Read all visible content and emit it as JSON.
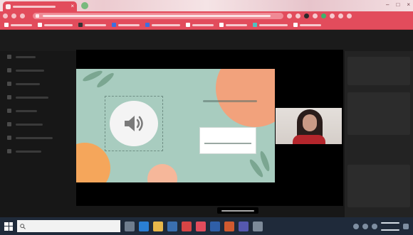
{
  "browser": {
    "active_tab": {
      "title": "",
      "icon": "video-call-icon"
    },
    "new_tab_icon": "plus-icon",
    "address": {
      "url": ""
    },
    "accent": "#e24c5c"
  },
  "bookmarks": [
    {
      "label": "",
      "icon": "bookmark-icon",
      "color": "#ffffff"
    },
    {
      "label": "",
      "icon": "bookmark-icon",
      "color": "#ffffff"
    },
    {
      "label": "",
      "icon": "bookmark-icon",
      "color": "#333333"
    },
    {
      "label": "",
      "icon": "bookmark-icon",
      "color": "#3c6fe0"
    },
    {
      "label": "",
      "icon": "bookmark-icon",
      "color": "#3c6fe0"
    },
    {
      "label": "",
      "icon": "bookmark-icon",
      "color": "#ffffff"
    },
    {
      "label": "",
      "icon": "bookmark-icon",
      "color": "#ffffff"
    },
    {
      "label": "",
      "icon": "bookmark-icon",
      "color": "#4ec2c0"
    },
    {
      "label": "",
      "icon": "bookmark-icon",
      "color": "#ffffff"
    }
  ],
  "sidebar": {
    "items": [
      "",
      "",
      "",
      "",
      "",
      "",
      "",
      ""
    ]
  },
  "presentation": {
    "title": "",
    "speaker_icon": "speaker-icon",
    "answer_field_value": "",
    "colors": {
      "background": "#a8ccbf",
      "coral": "#f2a27c",
      "orange": "#f5a65b"
    }
  },
  "participant": {
    "name": "",
    "video": "participant-video"
  },
  "tooltip": {
    "text": ""
  },
  "taskbar": {
    "search_placeholder": "",
    "apps": [
      {
        "icon": "task-view-icon",
        "color": "#6f7d8e"
      },
      {
        "icon": "edge-icon",
        "color": "#2a7fd4"
      },
      {
        "icon": "file-explorer-icon",
        "color": "#e8b84a"
      },
      {
        "icon": "store-icon",
        "color": "#3a6fb0"
      },
      {
        "icon": "mail-icon",
        "color": "#d64545"
      },
      {
        "icon": "chrome-icon",
        "color": "#e24c5c"
      },
      {
        "icon": "word-icon",
        "color": "#2f5fa8"
      },
      {
        "icon": "powerpoint-icon",
        "color": "#d15a2f"
      },
      {
        "icon": "teams-icon",
        "color": "#5558af"
      },
      {
        "icon": "settings-icon",
        "color": "#7d8a99"
      }
    ],
    "clock": {
      "time": "",
      "date": ""
    }
  }
}
